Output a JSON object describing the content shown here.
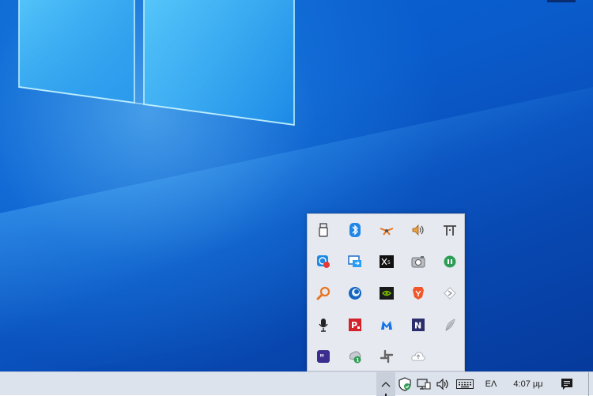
{
  "taskbar": {
    "language": "ΕΛ",
    "clock": "4:07 μμ"
  },
  "tray_overflow": {
    "icons": [
      "usb-drive-icon",
      "bluetooth-icon",
      "network-flower-icon",
      "volume-icon",
      "tt-app-icon",
      "screen-recorder-icon",
      "remote-desktop-icon",
      "xbox-icon",
      "camera-icon",
      "green-toggle-icon",
      "magnifier-search-icon",
      "backup-app-icon",
      "nvidia-icon",
      "brave-icon",
      "diamond-app-icon",
      "microphone-icon",
      "pdf-app-icon",
      "malwarebytes-icon",
      "onenote-icon",
      "feather-icon",
      "quote-app-icon",
      "update-badge-icon",
      "slack-icon",
      "onedrive-icon"
    ]
  },
  "colors": {
    "desktop": "#0a5ccc",
    "taskbar": "#dde3ec",
    "tray_popup": "#e6e9ef"
  }
}
